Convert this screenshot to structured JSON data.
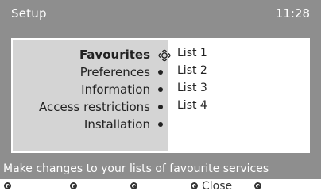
{
  "header": {
    "title": "Setup",
    "clock": "11:28"
  },
  "menu": {
    "items": [
      {
        "label": "Favourites",
        "active": true
      },
      {
        "label": "Preferences"
      },
      {
        "label": "Information"
      },
      {
        "label": "Access restrictions"
      },
      {
        "label": "Installation"
      }
    ]
  },
  "list": {
    "items": [
      "List 1",
      "List 2",
      "List 3",
      "List 4"
    ]
  },
  "help": {
    "text": "Make changes to your lists of favourite services"
  },
  "keys": [
    {
      "label": ""
    },
    {
      "label": ""
    },
    {
      "label": ""
    },
    {
      "label": "Close"
    },
    {
      "label": ""
    }
  ],
  "icons": {
    "active_item": "navigation-cross-icon",
    "menu_item": "bullet-icon",
    "key": "color-key-dot-icon"
  },
  "colors": {
    "background": "#8e8e8e",
    "menu_pane": "#d4d4d4",
    "panel": "#ffffff",
    "text": "#222222"
  }
}
